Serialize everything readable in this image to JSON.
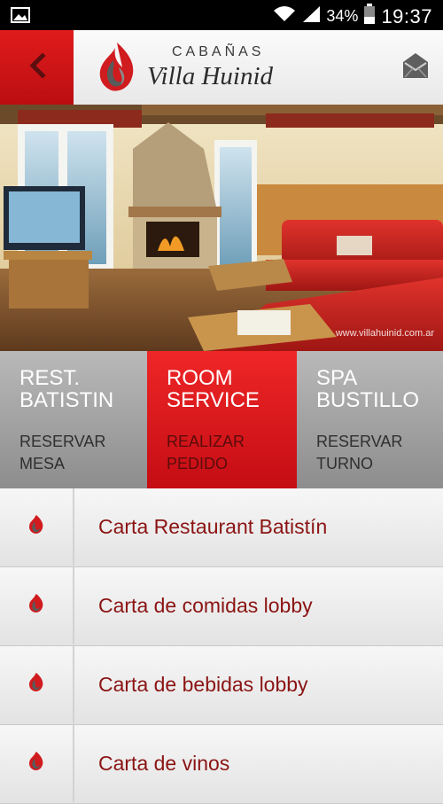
{
  "status_bar": {
    "battery": "34%",
    "time": "19:37"
  },
  "header": {
    "logo_top": "CABAÑAS",
    "logo_main": "Villa Huinid",
    "back_icon": "chevron-left-icon",
    "mail_icon": "envelope-icon"
  },
  "hero": {
    "credit": "www.villahuinid.com.ar"
  },
  "tabs": [
    {
      "title": "REST. BATISTIN",
      "subtitle": "RESERVAR MESA",
      "active": false
    },
    {
      "title": "ROOM SERVICE",
      "subtitle": "REALIZAR PEDIDO",
      "active": true
    },
    {
      "title": "SPA BUSTILLO",
      "subtitle": "RESERVAR TURNO",
      "active": false
    }
  ],
  "menu": [
    {
      "label": "Carta Restaurant Batistín"
    },
    {
      "label": "Carta de comidas lobby"
    },
    {
      "label": "Carta de bebidas lobby"
    },
    {
      "label": "Carta de vinos"
    }
  ],
  "colors": {
    "accent": "#d3121a",
    "menu_text": "#8b1414",
    "tab_gray": "#a3a3a3"
  }
}
